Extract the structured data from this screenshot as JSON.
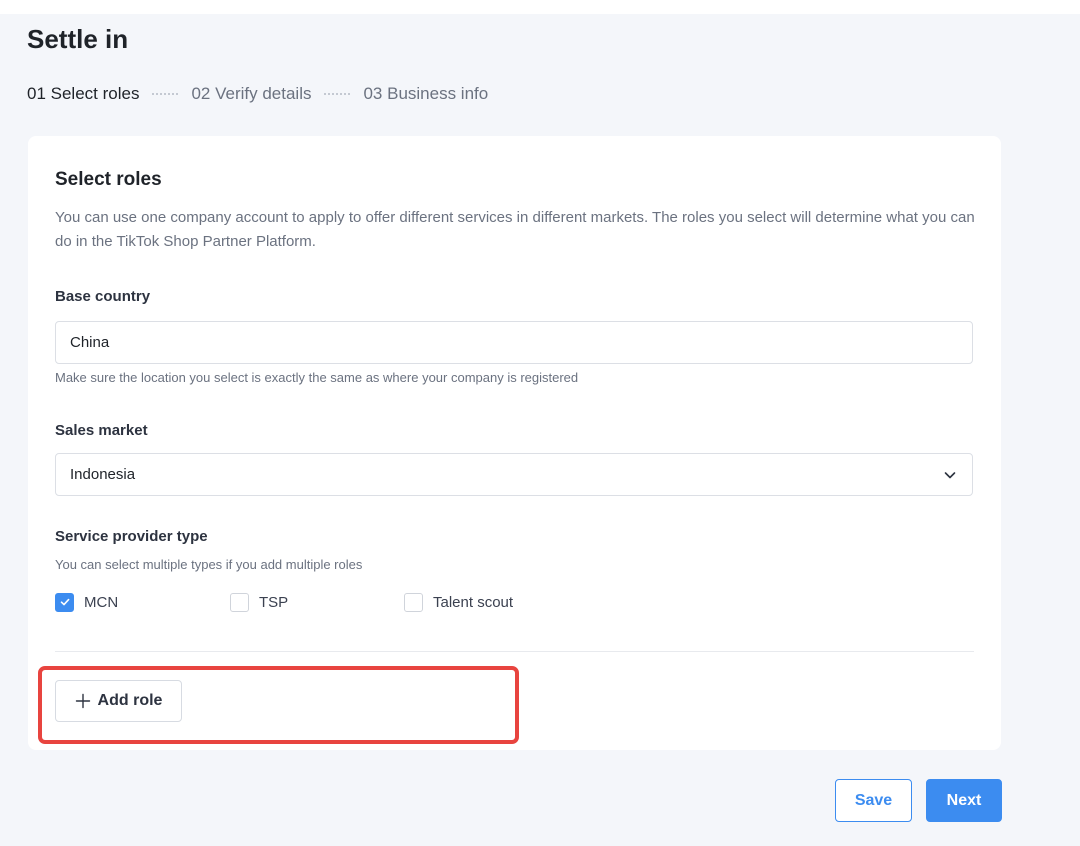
{
  "page": {
    "title": "Settle in"
  },
  "steps": [
    {
      "label": "01 Select roles",
      "active": true
    },
    {
      "label": "02 Verify details",
      "active": false
    },
    {
      "label": "03 Business info",
      "active": false
    }
  ],
  "form": {
    "title": "Select roles",
    "description": "You can use one company account to apply to offer different services in different markets. The roles you select will determine what you can do in the TikTok Shop Partner Platform.",
    "base_country": {
      "label": "Base country",
      "value": "China",
      "hint": "Make sure the location you select is exactly the same as where your company is registered"
    },
    "sales_market": {
      "label": "Sales market",
      "value": "Indonesia"
    },
    "service_provider": {
      "label": "Service provider type",
      "hint": "You can select multiple types if you add multiple roles",
      "options": [
        {
          "label": "MCN",
          "checked": true
        },
        {
          "label": "TSP",
          "checked": false
        },
        {
          "label": "Talent scout",
          "checked": false
        }
      ]
    },
    "add_role_label": "Add role"
  },
  "actions": {
    "save_label": "Save",
    "next_label": "Next"
  },
  "colors": {
    "accent": "#3c8cf0",
    "highlight": "#e8443f",
    "background": "#f4f6fa"
  },
  "icons": {
    "chevron": "chevron-down-icon",
    "check": "check-icon",
    "plus": "plus-icon"
  }
}
